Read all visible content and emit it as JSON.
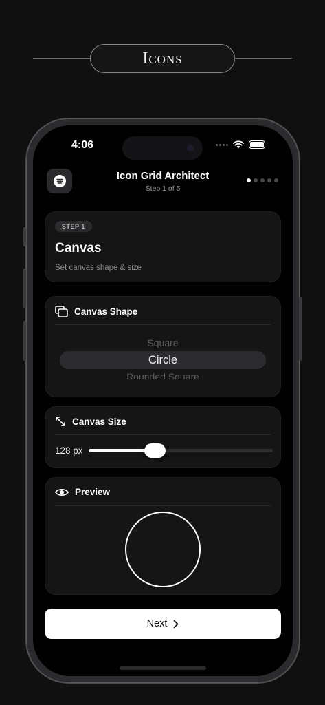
{
  "banner": {
    "title": "Icons"
  },
  "status_bar": {
    "time": "4:06"
  },
  "header": {
    "title": "Icon Grid Architect",
    "step_label": "Step 1 of 5",
    "pager": {
      "total": 5,
      "active": 1
    }
  },
  "step_card": {
    "badge": "STEP 1",
    "title": "Canvas",
    "subtitle": "Set canvas shape & size"
  },
  "shape_card": {
    "title": "Canvas Shape",
    "icon": "layers-icon",
    "options": [
      "Square",
      "Circle",
      "Rounded Square"
    ],
    "selected": "Circle"
  },
  "size_card": {
    "title": "Canvas Size",
    "icon": "expand-icon",
    "value_label": "128 px",
    "slider_fraction": 0.36
  },
  "preview_card": {
    "title": "Preview",
    "icon": "eye-icon"
  },
  "next_button": {
    "label": "Next",
    "icon": "chevron-right-icon"
  },
  "colors": {
    "background": "#111011",
    "screen": "#000000",
    "card": "#151515",
    "accent": "#ffffff",
    "muted": "#8e8e8e"
  }
}
